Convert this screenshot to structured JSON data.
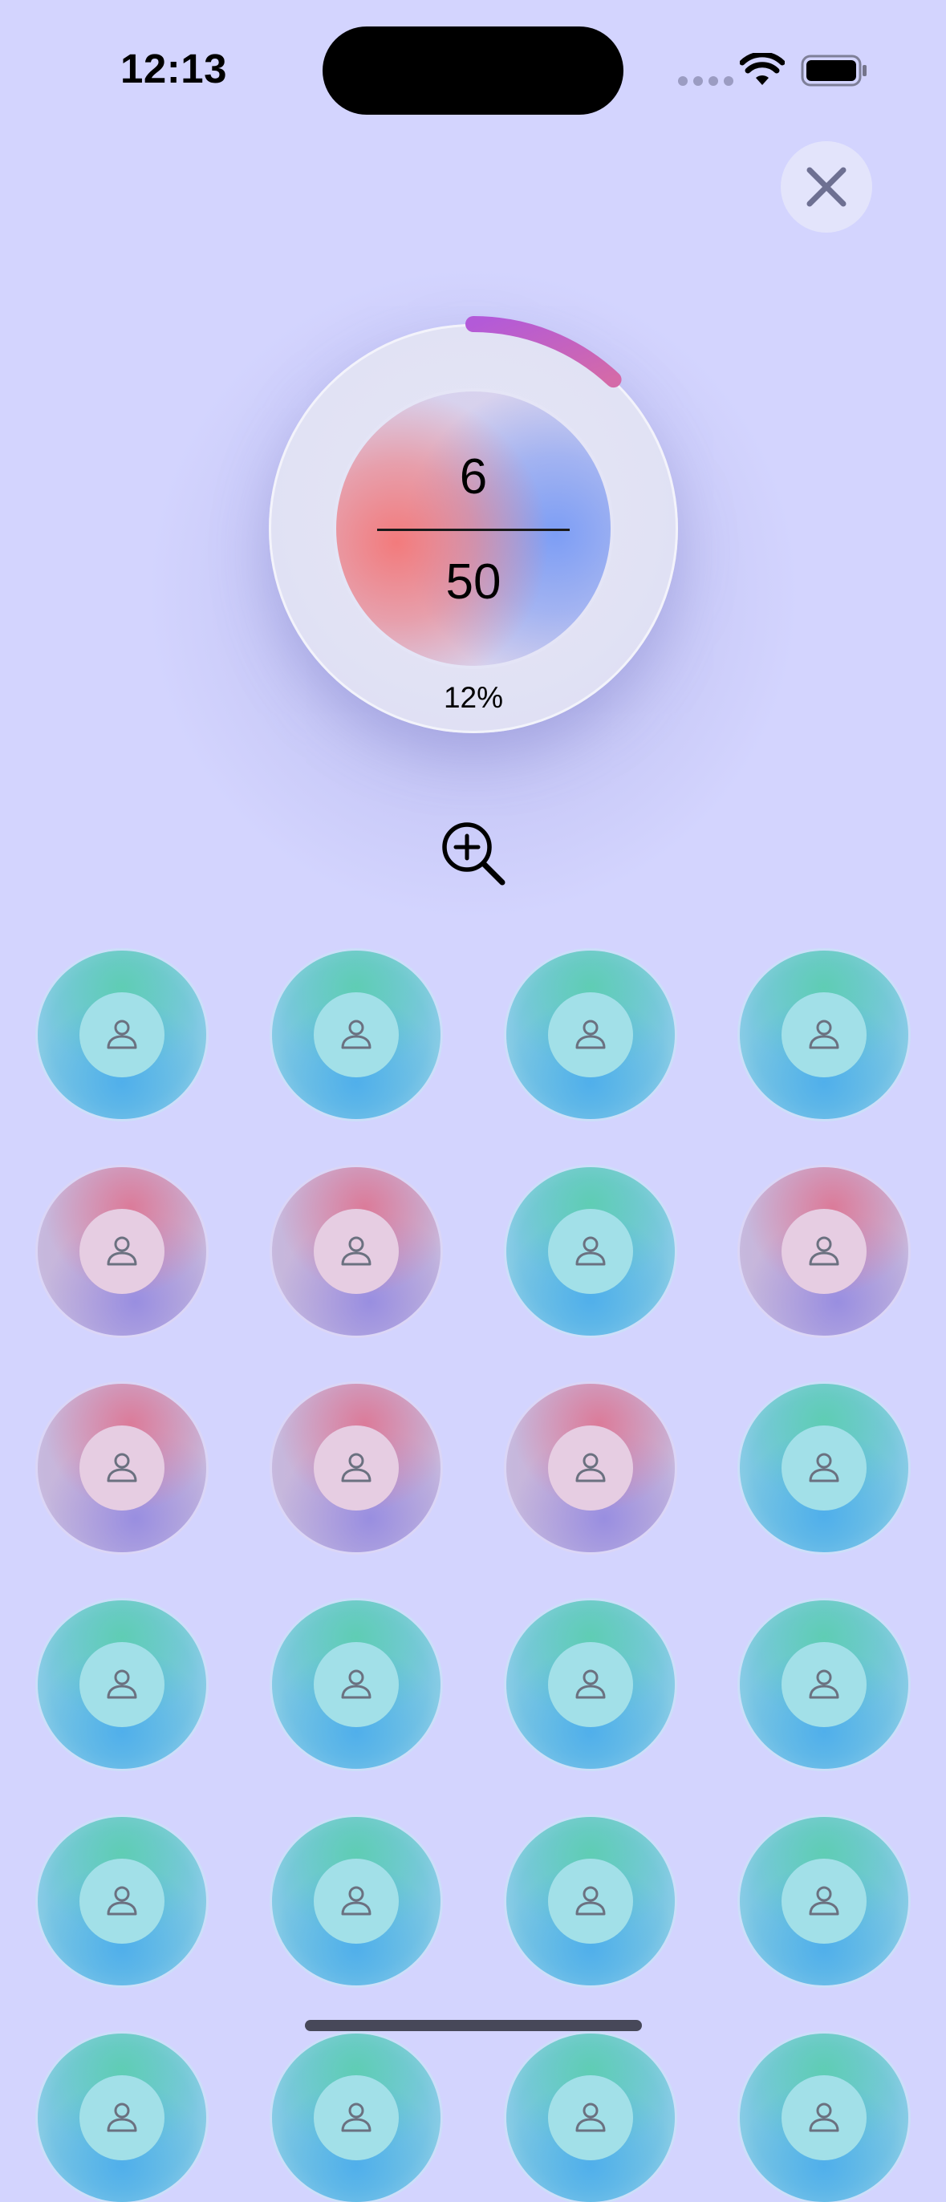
{
  "status_bar": {
    "time": "12:13"
  },
  "progress": {
    "current": "6",
    "total": "50",
    "percent_label": "12%",
    "fraction": 0.12,
    "arc_color_start": "#b35ad8",
    "arc_color_end": "#d46aa8"
  },
  "controls": {
    "close_icon": "close-icon",
    "zoom_icon": "zoom-in-icon"
  },
  "grid": {
    "columns": 4,
    "cells": [
      "teal",
      "teal",
      "teal",
      "teal",
      "pink",
      "pink",
      "teal",
      "pink",
      "pink",
      "pink",
      "pink",
      "teal",
      "teal",
      "teal",
      "teal",
      "teal",
      "teal",
      "teal",
      "teal",
      "teal",
      "teal",
      "teal",
      "teal",
      "teal"
    ],
    "cell_icon": "person-icon"
  }
}
